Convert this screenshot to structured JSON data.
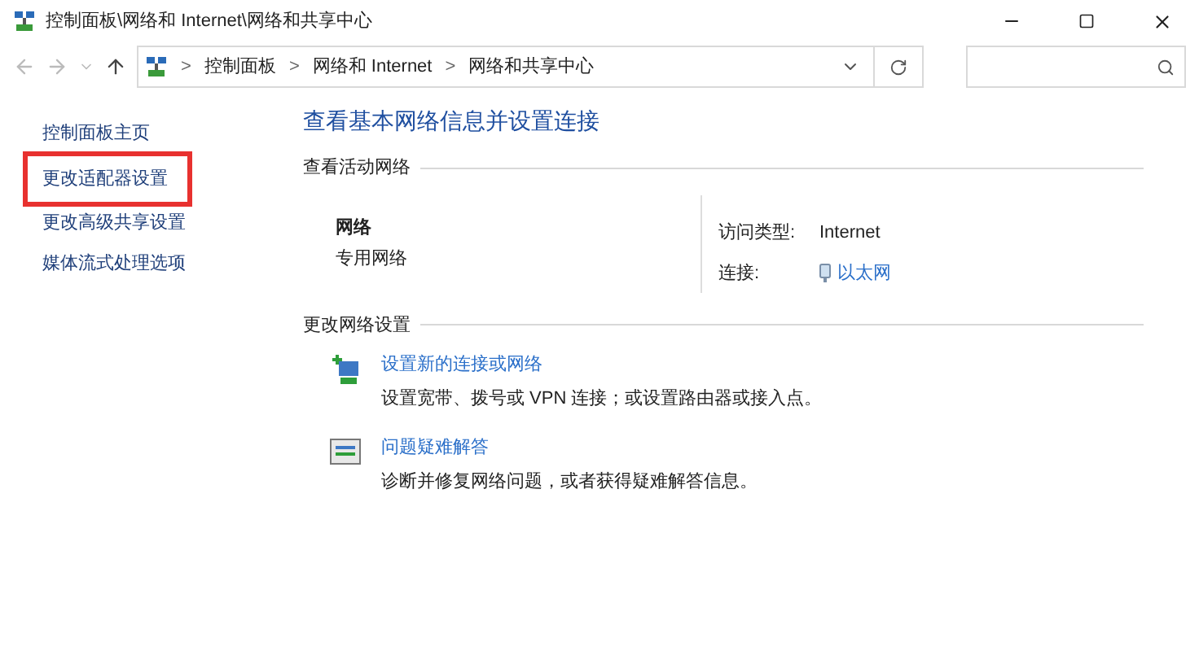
{
  "window": {
    "title": "控制面板\\网络和 Internet\\网络和共享中心"
  },
  "address_bar": {
    "breadcrumbs": [
      "控制面板",
      "网络和 Internet",
      "网络和共享中心"
    ],
    "separator": ">"
  },
  "sidebar": {
    "items": [
      {
        "label": "控制面板主页",
        "highlighted": false
      },
      {
        "label": "更改适配器设置",
        "highlighted": true
      },
      {
        "label": "更改高级共享设置",
        "highlighted": false
      },
      {
        "label": "媒体流式处理选项",
        "highlighted": false
      }
    ]
  },
  "main": {
    "heading": "查看基本网络信息并设置连接",
    "active_networks": {
      "title": "查看活动网络",
      "network_name": "网络",
      "network_type": "专用网络",
      "access_type_label": "访问类型:",
      "access_type": "Internet",
      "connection_label": "连接:",
      "connection": "以太网"
    },
    "change_settings": {
      "title": "更改网络设置",
      "tasks": [
        {
          "kind": "new-connection",
          "link": "设置新的连接或网络",
          "description": "设置宽带、拨号或 VPN 连接；或设置路由器或接入点。"
        },
        {
          "kind": "troubleshoot",
          "link": "问题疑难解答",
          "description": "诊断并修复网络问题，或者获得疑难解答信息。"
        }
      ]
    }
  }
}
